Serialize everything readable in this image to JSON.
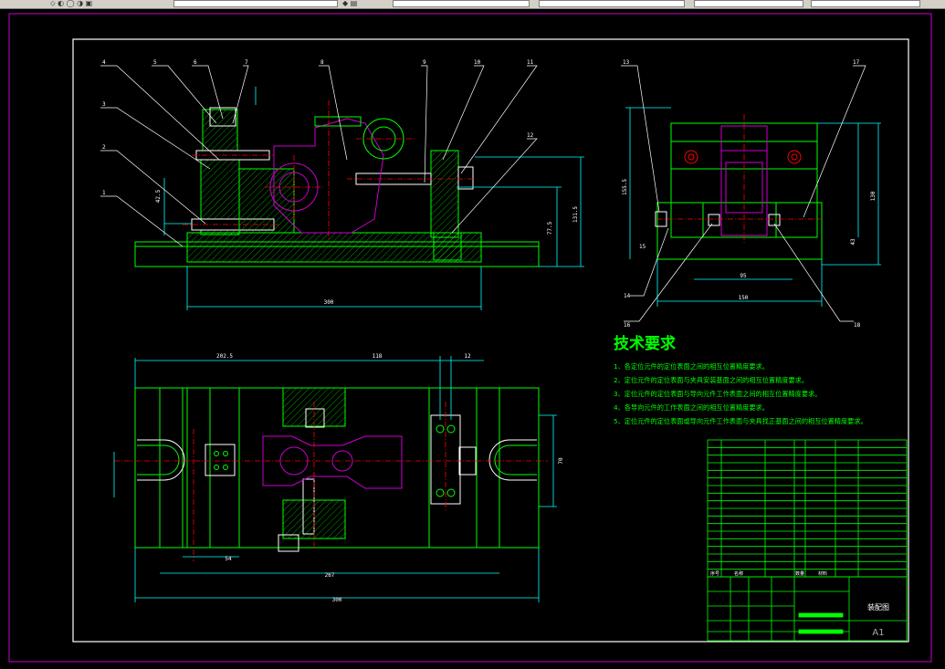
{
  "drawing": {
    "balloons": [
      "1",
      "2",
      "3",
      "4",
      "5",
      "6",
      "7",
      "8",
      "9",
      "10",
      "11",
      "12",
      "13",
      "14",
      "15",
      "16",
      "17",
      "18"
    ],
    "dims_front": {
      "overall_width": "300",
      "height_a": "77.5",
      "height_b": "131.5",
      "left_vertical": "42.5"
    },
    "dims_side": {
      "height_left": "155.5",
      "height_right": "130",
      "height_small": "43",
      "width_inner": "95",
      "width_outer": "150"
    },
    "dims_top": {
      "top_a": "202.5",
      "top_b": "118",
      "top_c": "12",
      "right_vertical": "70",
      "bottom_small": "54",
      "bottom_mid": "267",
      "bottom_total": "300"
    }
  },
  "tech": {
    "title": "技术要求",
    "items": [
      "1、各定位元件的定位表面之间的相互位置精度要求。",
      "2、定位元件的定位表面与夹具安装基面之间的相互位置精度要求。",
      "3、定位元件的定位表面与导向元件工作表面之间的相互位置精度要求。",
      "4、各导向元件的工作表面之间的相互位置精度要求。",
      "5、定位元件的定位表面或导向元件工作表面与夹具找正基面之间的相互位置精度要求。"
    ]
  },
  "title_block": {
    "header": {
      "col_seq": "序号",
      "col_name": "名称",
      "col_qty": "数量",
      "col_mat": "材料"
    },
    "drawing_name": "装配图",
    "sheet_size": "A1"
  },
  "colors": {
    "frame": "#cc00cc",
    "border": "#ffffff",
    "outline": "#00ff00",
    "part": "#cc00cc",
    "center": "#ff0000",
    "dimension": "#00ffff",
    "text": "#00ff00",
    "leader": "#ffffff"
  }
}
